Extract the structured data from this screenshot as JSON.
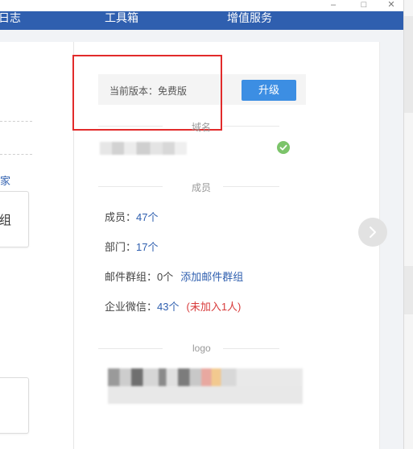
{
  "window": {
    "minimize_glyph": "–",
    "maximize_glyph": "□",
    "close_glyph": "✕"
  },
  "nav": {
    "items": [
      {
        "label": "日志"
      },
      {
        "label": "工具箱"
      },
      {
        "label": "增值服务"
      }
    ]
  },
  "left_panel": {
    "link_text": "家",
    "card_text": "组"
  },
  "version": {
    "label": "当前版本：免费版",
    "upgrade_button": "升级"
  },
  "sections": {
    "domain": "域名",
    "members": "成员",
    "logo": "logo"
  },
  "stats": {
    "members_label": "成员：",
    "members_value": "47个",
    "departments_label": "部门：",
    "departments_value": "17个",
    "mail_groups_label": "邮件群组：",
    "mail_groups_value": "0个",
    "add_mail_group_link": "添加邮件群组",
    "wechat_label": "企业微信：",
    "wechat_value": "43个",
    "wechat_note": "(未加入1人)"
  },
  "colors": {
    "nav_bg": "#2f5faf",
    "accent_link": "#2f5faf",
    "upgrade_button": "#3c8ee3",
    "highlight_border": "#e22b2b",
    "warning_text": "#d83b3b",
    "check_green": "#7cc46a"
  },
  "icons": {
    "domain_status": "check-circle-icon",
    "next": "chevron-right-icon"
  }
}
